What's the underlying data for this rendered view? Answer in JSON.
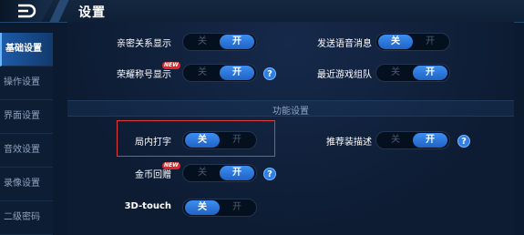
{
  "header": {
    "title": "设置"
  },
  "sidebar": {
    "items": [
      {
        "label": "基础设置",
        "active": true
      },
      {
        "label": "操作设置"
      },
      {
        "label": "界面设置"
      },
      {
        "label": "音效设置"
      },
      {
        "label": "录像设置"
      },
      {
        "label": "二级密码"
      }
    ]
  },
  "toggle_labels": {
    "off": "关",
    "on": "开"
  },
  "settings": {
    "intimacy": {
      "label": "亲密关系显示",
      "state": "on"
    },
    "voice_message": {
      "label": "发送语音消息",
      "state": "off"
    },
    "honor_title": {
      "label": "荣耀称号显示",
      "state": "on",
      "badge": "NEW",
      "help": "?"
    },
    "recent_team": {
      "label": "最近游戏组队",
      "state": "on"
    },
    "ingame_typing": {
      "label": "局内打字",
      "state": "off"
    },
    "recommend_gear": {
      "label": "推荐装描述",
      "state": "on",
      "help": "?"
    },
    "gold_return": {
      "label": "金币回赠",
      "state": "on",
      "badge": "NEW",
      "help": "?"
    },
    "touch3d": {
      "label": "3D-touch",
      "state": "off"
    }
  },
  "section": {
    "title": "功能设置"
  },
  "colors": {
    "accent": "#2f7ee0",
    "highlight": "#e03a3a",
    "badge": "#e0262a"
  }
}
